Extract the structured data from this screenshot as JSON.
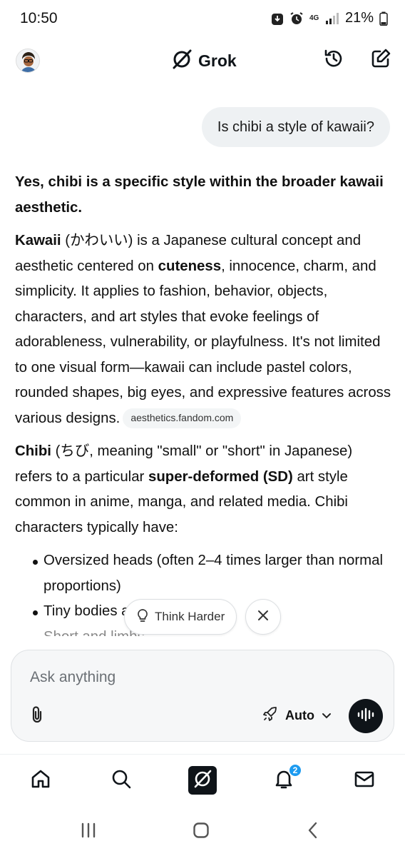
{
  "status_bar": {
    "time": "10:50",
    "network": "4G",
    "battery": "21%"
  },
  "header": {
    "brand": "Grok",
    "avatar_icon": "avatar",
    "history_icon": "history-icon",
    "compose_icon": "edit-icon"
  },
  "conversation": {
    "user_message": "Is chibi a style of kawaii?",
    "answer": {
      "headline": "Yes, chibi is a specific style within the broader kawaii aesthetic.",
      "p1_term": "Kawaii",
      "p1_a": " (かわいい) is a Japanese cultural concept and aesthetic centered on ",
      "p1_bold": "cuteness",
      "p1_b": ", innocence, charm, and simplicity. It applies to fashion, behavior, objects, characters, and art styles that evoke feelings of adorableness, vulnerability, or playfulness. It's not limited to one visual form—kawaii can include pastel colors, rounded shapes, big eyes, and expressive features across various designs.",
      "source_chip": "aesthetics.fandom.com",
      "p2_term": "Chibi",
      "p2_a": " (ちび, meaning \"small\" or \"short\" in Japanese) refers to a particular ",
      "p2_bold": "super-deformed (SD)",
      "p2_b": " art style common in anime, manga, and related media. Chibi characters typically have:",
      "bullets": [
        "Oversized heads (often 2–4 times larger than normal proportions)",
        "Tiny bodies a",
        "Short and limbs"
      ]
    }
  },
  "think_harder": {
    "label": "Think Harder"
  },
  "composer": {
    "placeholder": "Ask anything",
    "mode": "Auto"
  },
  "bottom_nav": {
    "notifications_count": "2"
  },
  "colors": {
    "text": "#0f1419",
    "bubble": "#eef1f3",
    "accent_badge": "#1d9bf0"
  }
}
